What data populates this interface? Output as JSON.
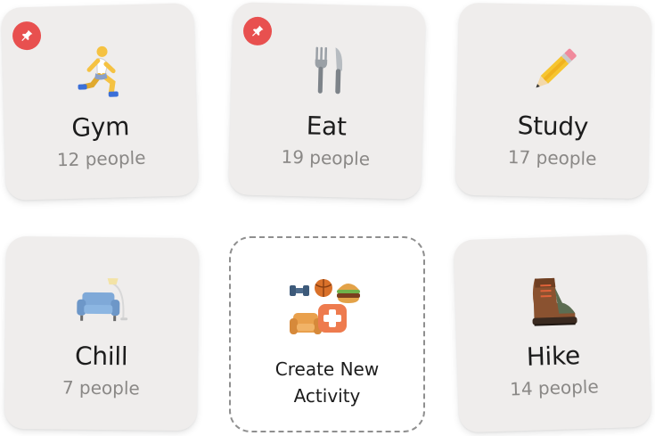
{
  "activities": [
    {
      "id": "gym",
      "title": "Gym",
      "count": "12 people",
      "icon": "runner-icon",
      "pinned": true
    },
    {
      "id": "eat",
      "title": "Eat",
      "count": "19 people",
      "icon": "fork-knife-icon",
      "pinned": true
    },
    {
      "id": "study",
      "title": "Study",
      "count": "17 people",
      "icon": "pencil-icon",
      "pinned": false
    },
    {
      "id": "chill",
      "title": "Chill",
      "count": "7 people",
      "icon": "sofa-icon",
      "pinned": false
    },
    {
      "id": "hike",
      "title": "Hike",
      "count": "14 people",
      "icon": "hiking-boot-icon",
      "pinned": false
    }
  ],
  "create": {
    "line1": "Create New",
    "line2": "Activity",
    "icon": "create-activity-icon"
  },
  "colors": {
    "card_bg": "#efedec",
    "pin_badge": "#e8504f",
    "title_text": "#1c1c1c",
    "count_text": "#8a8886",
    "dashed_border": "#8f8f8f"
  }
}
